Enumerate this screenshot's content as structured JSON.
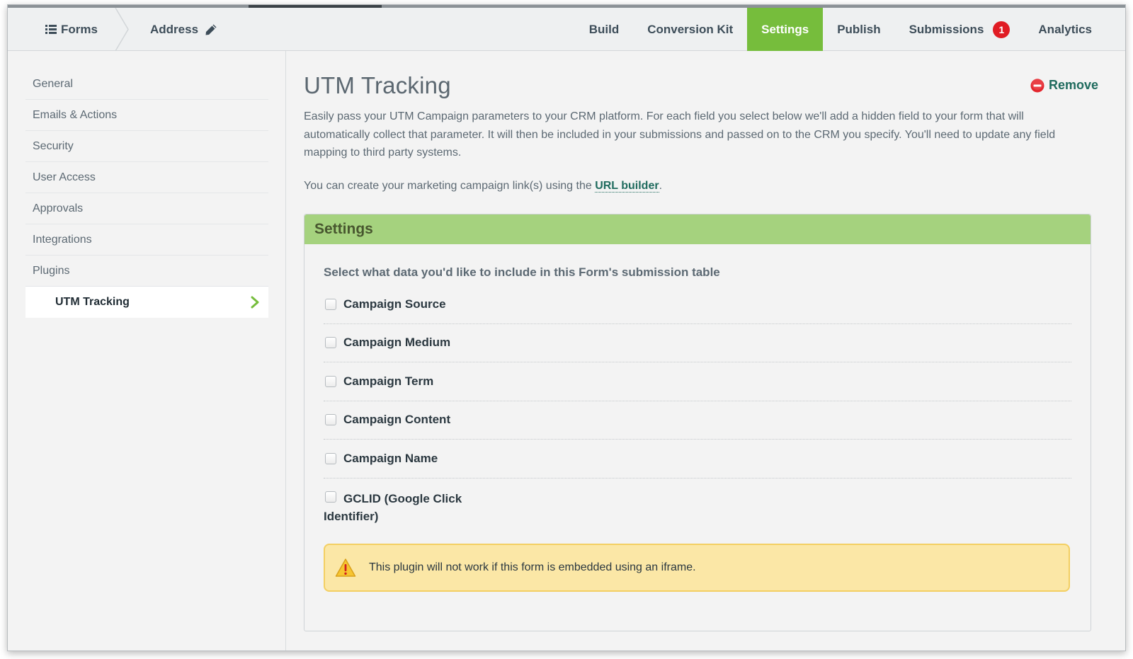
{
  "topnav": {
    "forms_label": "Forms",
    "address_label": "Address",
    "tabs": [
      {
        "label": "Build"
      },
      {
        "label": "Conversion Kit"
      },
      {
        "label": "Settings"
      },
      {
        "label": "Publish"
      },
      {
        "label": "Submissions",
        "badge": "1"
      },
      {
        "label": "Analytics"
      }
    ],
    "active_tab": "Settings",
    "active_color": "#76bd3c",
    "badge_color": "#e01c24"
  },
  "sidebar": {
    "items": [
      {
        "label": "General"
      },
      {
        "label": "Emails & Actions"
      },
      {
        "label": "Security"
      },
      {
        "label": "User Access"
      },
      {
        "label": "Approvals"
      },
      {
        "label": "Integrations"
      },
      {
        "label": "Plugins"
      },
      {
        "label": "UTM Tracking"
      }
    ],
    "active_item": "UTM Tracking"
  },
  "main": {
    "title": "UTM Tracking",
    "remove_label": "Remove",
    "description": "Easily pass your UTM Campaign parameters to your CRM platform. For each field you select below we'll add a hidden field to your form that will automatically collect that parameter. It will then be included in your submissions and passed on to the CRM you specify. You'll need to update any field mapping to third party systems.",
    "builder_prefix": "You can create your marketing campaign link(s) using the ",
    "builder_link": "URL builder",
    "builder_suffix": "."
  },
  "settings": {
    "header": "Settings",
    "header_color": "#a5d27e",
    "select_label": "Select what data you'd like to include in this Form's submission table",
    "options": [
      {
        "label": "Campaign Source",
        "checked": false
      },
      {
        "label": "Campaign Medium",
        "checked": false
      },
      {
        "label": "Campaign Term",
        "checked": false
      },
      {
        "label": "Campaign Content",
        "checked": false
      },
      {
        "label": "Campaign Name",
        "checked": false
      },
      {
        "label": "GCLID (Google Click Identifier)",
        "checked": false
      }
    ],
    "warning": "This plugin will not work if this form is embedded using an iframe."
  }
}
